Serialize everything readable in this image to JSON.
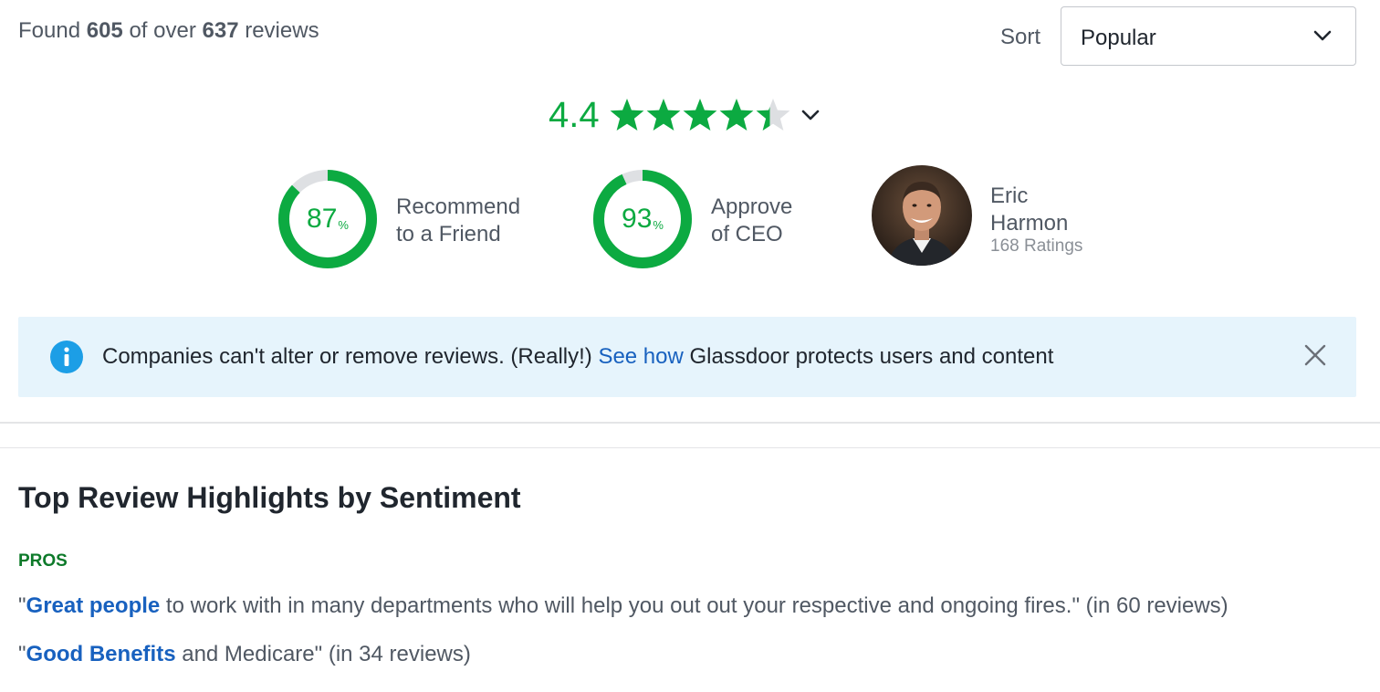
{
  "summary": {
    "found_prefix": "Found",
    "found_count": "605",
    "found_middle": "of over",
    "total_count": "637",
    "found_suffix": "reviews"
  },
  "sort": {
    "label": "Sort",
    "selected": "Popular",
    "icon": "chevron-down-icon"
  },
  "rating": {
    "value": "4.4",
    "stars_filled": 4.4,
    "stars_total": 5,
    "star_color": "#0caa41",
    "star_empty_color": "#dddfe2",
    "icon": "chevron-down-icon"
  },
  "metrics": [
    {
      "percent": "87",
      "percent_sign": "%",
      "fraction": 0.87,
      "line1": "Recommend",
      "line2": "to a Friend"
    },
    {
      "percent": "93",
      "percent_sign": "%",
      "fraction": 0.93,
      "line1": "Approve",
      "line2": "of CEO"
    }
  ],
  "ceo": {
    "first_name": "Eric",
    "last_name": "Harmon",
    "ratings": "168 Ratings"
  },
  "banner": {
    "icon": "info-icon",
    "text_before": "Companies can't alter or remove reviews. (Really!)",
    "link": "See how",
    "text_after": "Glassdoor protects users and content",
    "close_icon": "close-icon",
    "bg_color": "#e6f4fc"
  },
  "highlights": {
    "title": "Top Review Highlights by Sentiment",
    "pros_label": "PROS",
    "items": [
      {
        "open_quote": "\"",
        "link": "Great people",
        "rest": "to work with in many departments who will help you out out your respective and ongoing fires.\" (in 60 reviews)"
      },
      {
        "open_quote": "\"",
        "link": "Good Benefits",
        "rest": "and Medicare\" (in 34 reviews)"
      }
    ]
  },
  "colors": {
    "brand_green": "#0caa41",
    "link_blue": "#1861bf",
    "pros_green": "#0d7a2a"
  }
}
